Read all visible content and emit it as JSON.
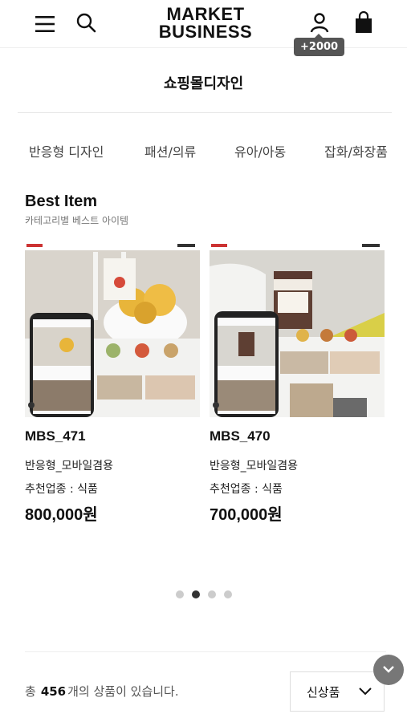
{
  "header": {
    "logo_line1": "MARKET",
    "logo_line2": "BUSINESS",
    "point_badge": "+2000",
    "icons": [
      "menu-icon",
      "search-icon",
      "user-icon",
      "shopping-bag-icon"
    ]
  },
  "page_title": "쇼핑몰디자인",
  "categories": [
    "반응형 디자인",
    "패션/의류",
    "유아/아동",
    "잡화/화장품"
  ],
  "best": {
    "title": "Best Item",
    "subtitle": "카테고리별 베스트 아이템"
  },
  "products": [
    {
      "name": "MBS_471",
      "type": "반응형_모바일겸용",
      "recommended": "추천업종 : 식품",
      "price": "800,000원"
    },
    {
      "name": "MBS_470",
      "type": "반응형_모바일겸용",
      "recommended": "추천업종 : 식품",
      "price": "700,000원"
    }
  ],
  "carousel": {
    "total_dots": 4,
    "active_dot": 2
  },
  "footer": {
    "count_prefix": "총",
    "count_value": "456",
    "count_suffix": "개의 상품이 있습니다.",
    "sort_selected": "신상품"
  },
  "colors": {
    "badge": "#555555",
    "dot_active": "#333333",
    "dot_inactive": "#cccccc",
    "fab": "#777777"
  }
}
